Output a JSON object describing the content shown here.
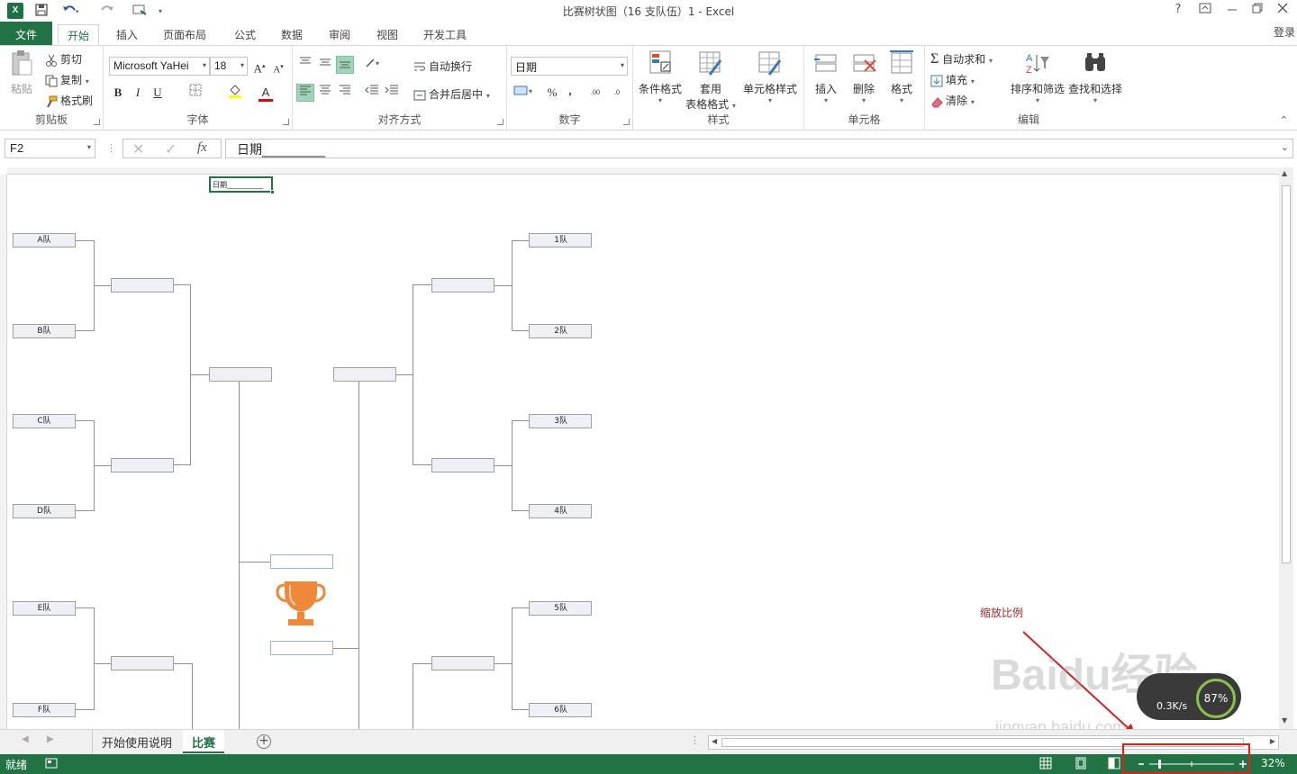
{
  "window": {
    "title": "比赛树状图（16 支队伍）1 - Excel",
    "help": "?",
    "login": "登录"
  },
  "tabs": [
    "文件",
    "开始",
    "插入",
    "页面布局",
    "公式",
    "数据",
    "审阅",
    "视图",
    "开发工具"
  ],
  "ribbon": {
    "clipboard": {
      "paste": "粘贴",
      "cut": "剪切",
      "copy": "复制",
      "format_painter": "格式刷",
      "label": "剪贴板"
    },
    "font": {
      "name": "Microsoft YaHei",
      "size": "18",
      "bold": "B",
      "italic": "I",
      "underline": "U",
      "grow": "A",
      "shrink": "A",
      "color_a": "A",
      "label": "字体"
    },
    "alignment": {
      "wrap": "自动换行",
      "merge": "合并后居中",
      "label": "对齐方式"
    },
    "number": {
      "format": "日期",
      "percent": "%",
      "comma": ",",
      "inc": ".00",
      "dec": ".0",
      "label": "数字"
    },
    "styles": {
      "conditional": "条件格式",
      "table_line1": "套用",
      "table_line2": "表格格式",
      "cell_styles": "单元格样式",
      "label": "样式"
    },
    "cells": {
      "insert": "插入",
      "delete": "删除",
      "format": "格式",
      "label": "单元格"
    },
    "editing": {
      "autosum": "自动求和",
      "fill": "填充",
      "clear": "清除",
      "sort": "排序和筛选",
      "find": "查找和选择",
      "label": "编辑"
    }
  },
  "formula_bar": {
    "name_box": "F2",
    "fx": "fx",
    "content": "日期__________"
  },
  "sheet": {
    "selected_cell_text": "日期__________",
    "left_teams": [
      "A队",
      "B队",
      "C队",
      "D队",
      "E队",
      "F队"
    ],
    "right_teams": [
      "1队",
      "2队",
      "3队",
      "4队",
      "5队",
      "6队"
    ],
    "annotation": "缩放比例",
    "watermark": "Baidu经验",
    "watermark_url": "jingyan.baidu.com",
    "speed_pct": "87",
    "speed_rate": "0.3K/s"
  },
  "sheet_tabs": {
    "tab1": "开始使用说明",
    "tab2": "比赛",
    "add": "+"
  },
  "status": {
    "ready": "就绪",
    "zoom": "32%",
    "zoom_level_pct": 32
  },
  "colors": {
    "excel_green": "#217346",
    "annotation_red": "#a52a2a",
    "trophy": "#f0883a",
    "box_fill": "#eef0f6"
  }
}
